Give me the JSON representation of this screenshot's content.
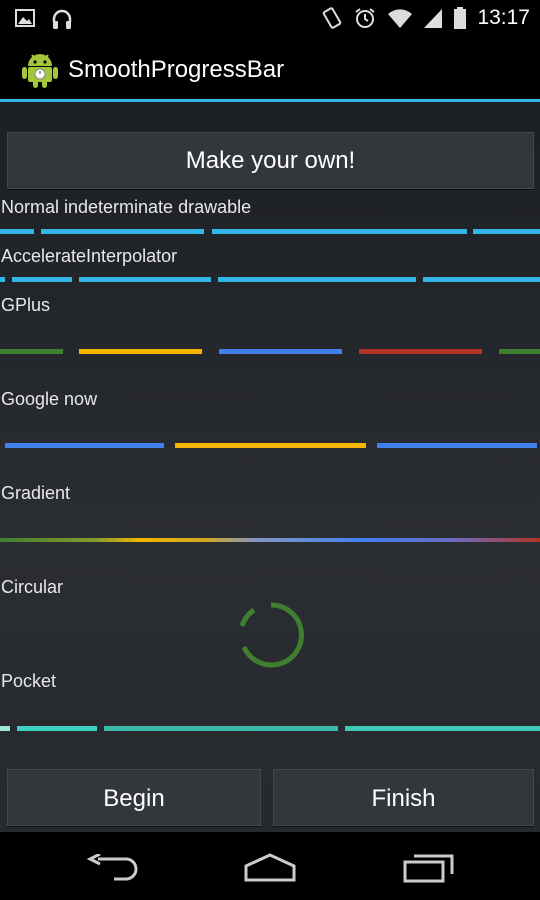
{
  "status_bar": {
    "time": "13:17",
    "left_icons": [
      "image-icon",
      "headphones-icon"
    ],
    "right_icons": [
      "vibrate-icon",
      "alarm-icon",
      "wifi-icon",
      "signal-icon",
      "battery-icon"
    ]
  },
  "action_bar": {
    "title": "SmoothProgressBar",
    "icon": "android-robot-icon",
    "accent_color": "#33b5e5"
  },
  "buttons": {
    "make_your_own": "Make your own!",
    "begin": "Begin",
    "finish": "Finish"
  },
  "sections": [
    {
      "label": "Normal indeterminate drawable",
      "type": "progress-bar",
      "colors": [
        "#33b5e5"
      ]
    },
    {
      "label": "AccelerateInterpolator",
      "type": "progress-bar",
      "colors": [
        "#33b5e5"
      ]
    },
    {
      "label": "GPlus",
      "type": "progress-bar",
      "colors": [
        "#3e802f",
        "#f4b400",
        "#427fed",
        "#b23424"
      ]
    },
    {
      "label": "Google now",
      "type": "progress-bar",
      "colors": [
        "#427fed",
        "#f4b400"
      ]
    },
    {
      "label": "Gradient",
      "type": "progress-bar",
      "colors": [
        "#3e802f",
        "#f4b400",
        "#427fed",
        "#b23424"
      ]
    },
    {
      "label": "Circular",
      "type": "spinner",
      "colors": [
        "#3e802f"
      ]
    },
    {
      "label": "Pocket",
      "type": "progress-bar",
      "colors": [
        "#3dd1c4",
        "#3ab8a8"
      ]
    }
  ],
  "nav_bar": {
    "icons": [
      "back-icon",
      "home-icon",
      "recent-apps-icon"
    ]
  }
}
